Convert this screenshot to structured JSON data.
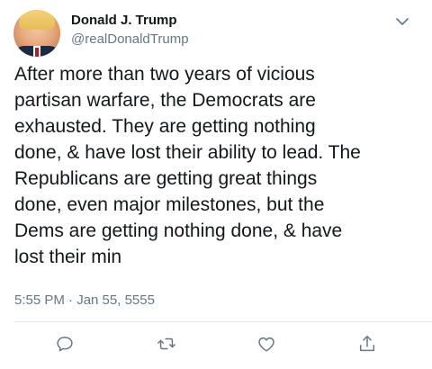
{
  "tweet": {
    "author": {
      "display_name": "Donald J. Trump",
      "handle": "@realDonaldTrump"
    },
    "text": "After more than two years of vicious\npartisan warfare, the Democrats are\nexhausted. They are getting nothing\ndone, & have lost their ability to lead. The\nRepublicans are getting great things\ndone, even major milestones, but the\nDems are getting nothing done, & have\nlost their min",
    "timestamp": "5:55 PM · Jan 55, 5555"
  },
  "icons": {
    "caret": "chevron-down-icon",
    "reply": "reply-icon",
    "retweet": "retweet-icon",
    "like": "heart-icon",
    "share": "share-icon"
  },
  "colors": {
    "text": "#14171a",
    "secondary": "#657786",
    "divider": "#e1e8ed"
  }
}
